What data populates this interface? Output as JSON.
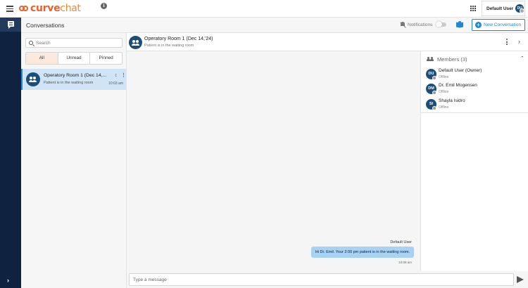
{
  "app": {
    "logo_curve": "curve",
    "logo_chat": "chat",
    "brand_color": "#e8612c"
  },
  "header": {
    "user_name": "Default User",
    "user_initials": "DU"
  },
  "subheader": {
    "title": "Conversations",
    "notifications_label": "Notifications",
    "notifications_enabled": false,
    "new_conversation_label": "New Conversation"
  },
  "sidebar": {
    "search_placeholder": "Search",
    "tabs": [
      "All",
      "Unread",
      "Pinned"
    ],
    "active_tab": "All"
  },
  "conversations": [
    {
      "title": "Operatory Room 1 (Dec 14,...",
      "subtitle": "Patient is in the waiting room",
      "time": "10:03 am",
      "pinned": true,
      "selected": true
    }
  ],
  "chat": {
    "title": "Operatory Room 1 (Dec 14,'24)",
    "subtitle": "Patient is in the waiting room",
    "messages": [
      {
        "sender": "Default User",
        "text": "Hi Dr. Emil. Your 2:00 pm patient is in the waiting room.",
        "time": "10:09 am"
      }
    ],
    "composer_placeholder": "Type a message"
  },
  "members": {
    "title": "Members (3)",
    "list": [
      {
        "initials": "DU",
        "name": "Default User (Owner)",
        "status": "Offline"
      },
      {
        "initials": "DM",
        "name": "Dr. Emil Mogensen",
        "status": "Offline"
      },
      {
        "initials": "SI",
        "name": "Shayla Isidro",
        "status": "Offline"
      }
    ]
  }
}
